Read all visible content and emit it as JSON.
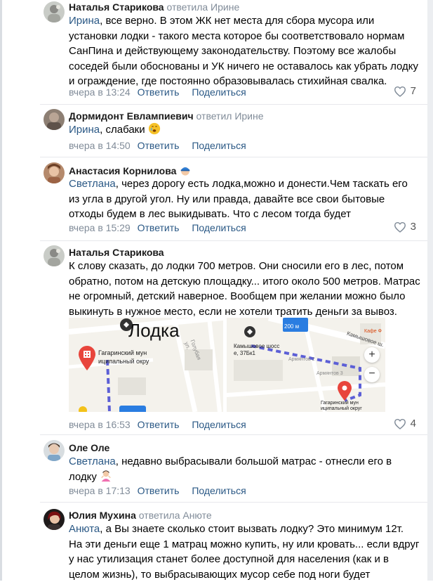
{
  "actions": {
    "reply": "Ответить",
    "share": "Поделиться"
  },
  "comments": [
    {
      "author": "Наталья Старикова",
      "replied": "ответила Ирине",
      "mention": "Ирина",
      "lines": [
        ", все верно. В этом ЖК нет места для сбора мусора или",
        "установки лодки - такого места которое бы соответствовало нормам",
        "СанПина и действующему законодательству. Поэтому все жалобы",
        "соседей были обоснованы и УК ничего не оставалось как убрать лодку",
        "и ограждение, где постоянно образовывалась стихийная свалка."
      ],
      "date": "вчера в 13:24",
      "likes": "7"
    },
    {
      "author": "Дормидонт Евлампиевич",
      "replied": "ответил Ирине",
      "mention": "Ирина",
      "lines": [
        ", слабаки"
      ],
      "date": "вчера в 14:50"
    },
    {
      "author": "Анастасия Корнилова",
      "mention": "Светлана",
      "lines": [
        ", через дорогу есть лодка,можно и донести.Чем таскать его",
        "из угла в другой угол. Ну или правда, давайте все свои бытовые",
        "отходы будем в лес выкидывать. Что с лесом тогда будет"
      ],
      "date": "вчера в 15:29",
      "likes": "3"
    },
    {
      "author": "Наталья Старикова",
      "lines": [
        "К слову сказать, до лодки 700 метров. Они сносили его в лес, потом",
        "обратно, потом на детскую площадку... итого около 500 метров. Матрас",
        "не огромный, детский наверное. Вообщем при желании можно было",
        "выкинуть в нужное место, если не хотели тратить деньги за вывоз."
      ],
      "map1": {
        "label": "Лодка",
        "district": [
          "Гагаринский мун",
          "иципальный окру"
        ],
        "street": "Голубая ул."
      },
      "map2": {
        "address": [
          "Камышовое шосс",
          "е, 37Бк1"
        ],
        "district": [
          "Гагаринский мун",
          "иципальный округ"
        ],
        "street1": "Армянтов 2",
        "street2": "Армянтов 3",
        "street3": "Камышовое ш.",
        "distance": "200 м",
        "cafe": "Кафе Ф",
        "zoom_in": "+",
        "zoom_out": "−"
      },
      "date": "вчера в 16:53",
      "likes": "4"
    },
    {
      "author": "Оле Оле",
      "mention": "Светлана",
      "lines": [
        ", недавно выбрасывали большой матрас - отнесли его в",
        "лодку"
      ],
      "date": "вчера в 17:13"
    },
    {
      "author": "Юлия Мухина",
      "replied": "ответила Анюте",
      "mention": "Анюта",
      "lines": [
        ", а Вы знаете сколько стоит вызвать лодку? Это минимум 12т.",
        "На эти деньги еще 1 матрац можно купить, ну или кровать... если вдруг",
        "у нас утилизация станет более доступной для населения (как и в",
        "целом жизнь), то выбрасывающих мусор себе под ноги будет"
      ]
    }
  ],
  "colors": {
    "link": "#2a5885",
    "muted": "#818c99",
    "route": "#5c5fd6",
    "pin": "#e8453c"
  }
}
